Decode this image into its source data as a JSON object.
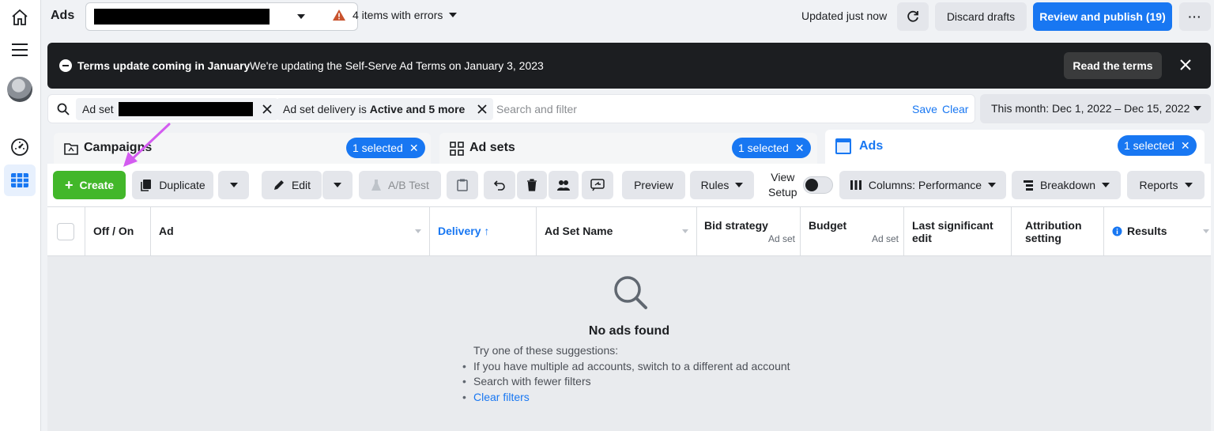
{
  "topbar": {
    "app_title": "Ads",
    "errors_label": "4 items with errors",
    "updated_label": "Updated just now",
    "discard_label": "Discard drafts",
    "review_label": "Review and publish (19)",
    "more_label": "···"
  },
  "banner": {
    "title": "Terms update coming in January",
    "text": "We're updating the Self-Serve Ad Terms on January 3, 2023",
    "button_label": "Read the terms"
  },
  "filters": {
    "chip1_label": "Ad set",
    "chip2_prefix": "Ad set delivery is ",
    "chip2_bold": "Active and 5 more",
    "search_placeholder": "Search and filter",
    "save_label": "Save",
    "clear_label": "Clear",
    "date_range": "This month: Dec 1, 2022 – Dec 15, 2022"
  },
  "tabs": [
    {
      "label": "Campaigns",
      "badge": "1 selected"
    },
    {
      "label": "Ad sets",
      "badge": "1 selected"
    },
    {
      "label": "Ads",
      "badge": "1 selected"
    }
  ],
  "toolbar": {
    "create_label": "Create",
    "duplicate_label": "Duplicate",
    "edit_label": "Edit",
    "ab_test_label": "A/B Test",
    "preview_label": "Preview",
    "rules_label": "Rules",
    "view_setup_line1": "View",
    "view_setup_line2": "Setup",
    "columns_label": "Columns: Performance",
    "breakdown_label": "Breakdown",
    "reports_label": "Reports"
  },
  "table": {
    "columns": {
      "off_on": "Off / On",
      "ad": "Ad",
      "delivery": "Delivery ↑",
      "ad_set_name": "Ad Set Name",
      "bid_strategy": "Bid strategy",
      "bid_strategy_sub": "Ad set",
      "budget": "Budget",
      "budget_sub": "Ad set",
      "last_edit_1": "Last significant",
      "last_edit_2": "edit",
      "attribution_1": "Attribution",
      "attribution_2": "setting",
      "results": "Results"
    },
    "empty": {
      "title": "No ads found",
      "intro": "Try one of these suggestions:",
      "suggestions": [
        "If you have multiple ad accounts, switch to a different ad account",
        "Search with fewer filters",
        "Clear filters"
      ]
    }
  },
  "colors": {
    "accent": "#1877f2",
    "create": "#42b72a",
    "annotation_arrow": "#d35bf0"
  }
}
